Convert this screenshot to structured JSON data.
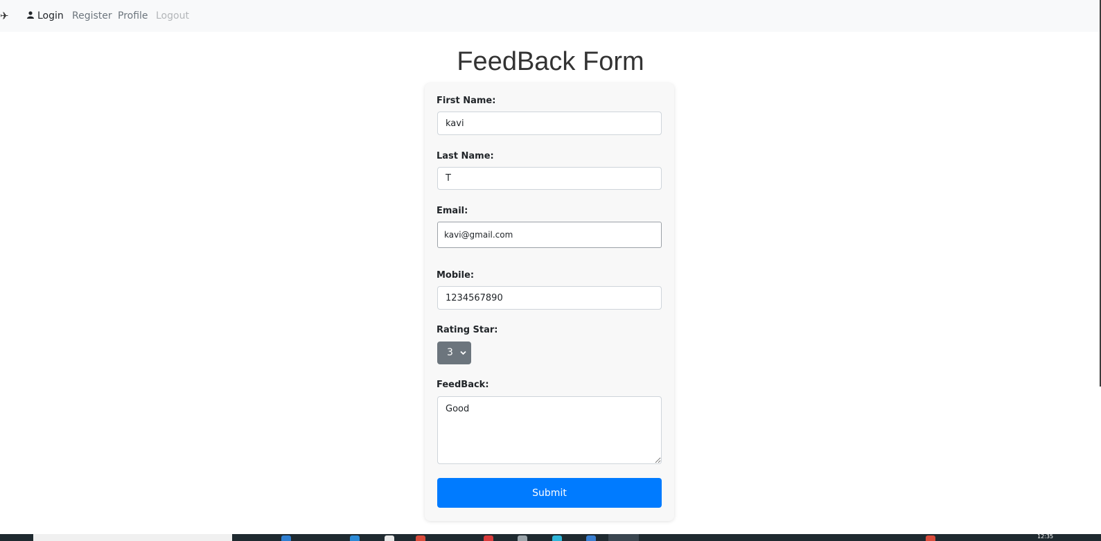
{
  "navbar": {
    "brand_icon": "airplane-icon",
    "login_label": "Login",
    "user_icon": "user-icon",
    "register_label": "Register",
    "profile_label": "Profile",
    "logout_label": "Logout"
  },
  "page": {
    "title": "FeedBack Form"
  },
  "form": {
    "first_name": {
      "label": "First Name:",
      "value": "kavi"
    },
    "last_name": {
      "label": "Last Name:",
      "value": "T"
    },
    "email": {
      "label": "Email:",
      "value": "kavi@gmail.com"
    },
    "mobile": {
      "label": "Mobile:",
      "value": "1234567890"
    },
    "rating": {
      "label": "Rating Star:",
      "value": "3"
    },
    "feedback": {
      "label": "FeedBack:",
      "value": "Good"
    },
    "submit_label": "Submit"
  },
  "taskbar": {
    "clock": "12:35"
  },
  "colors": {
    "primary": "#007bff",
    "select_bg": "#6c757d",
    "navbar_bg": "#f8f9fa"
  }
}
